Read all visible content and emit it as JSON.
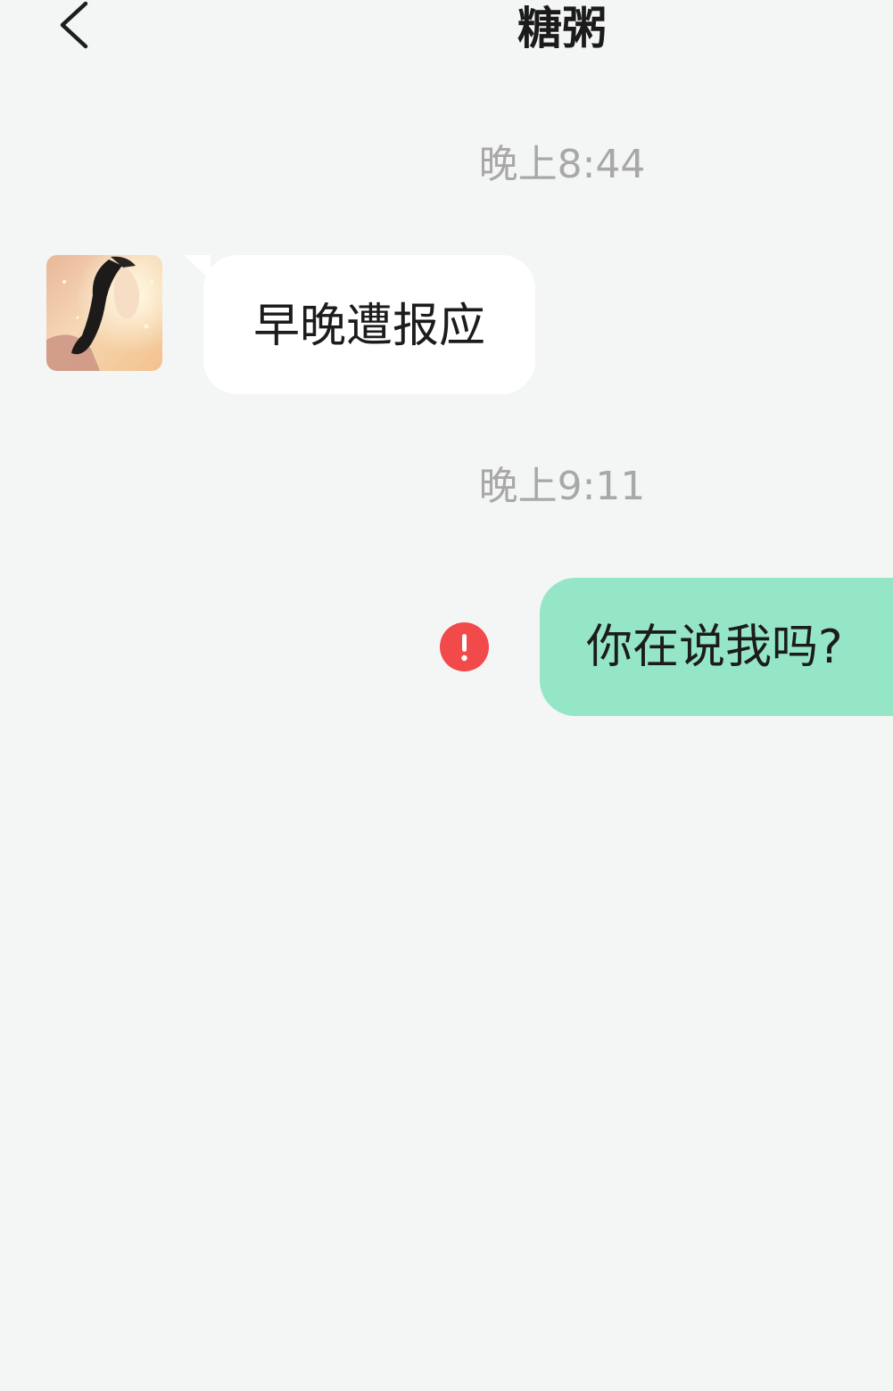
{
  "header": {
    "title": "糖粥",
    "back_icon": "chevron-left-icon"
  },
  "messages": [
    {
      "timestamp": "晚上8:44",
      "direction": "incoming",
      "text": "早晚遭报应"
    },
    {
      "timestamp": "晚上9:11",
      "direction": "outgoing",
      "text": "你在说我吗?",
      "status_icon": "send-failed-icon"
    }
  ],
  "colors": {
    "background": "#f4f5f5",
    "incoming_bubble": "#ffffff",
    "outgoing_bubble": "#95e6c6",
    "error": "#f2494b",
    "timestamp": "#a8a8a8"
  }
}
